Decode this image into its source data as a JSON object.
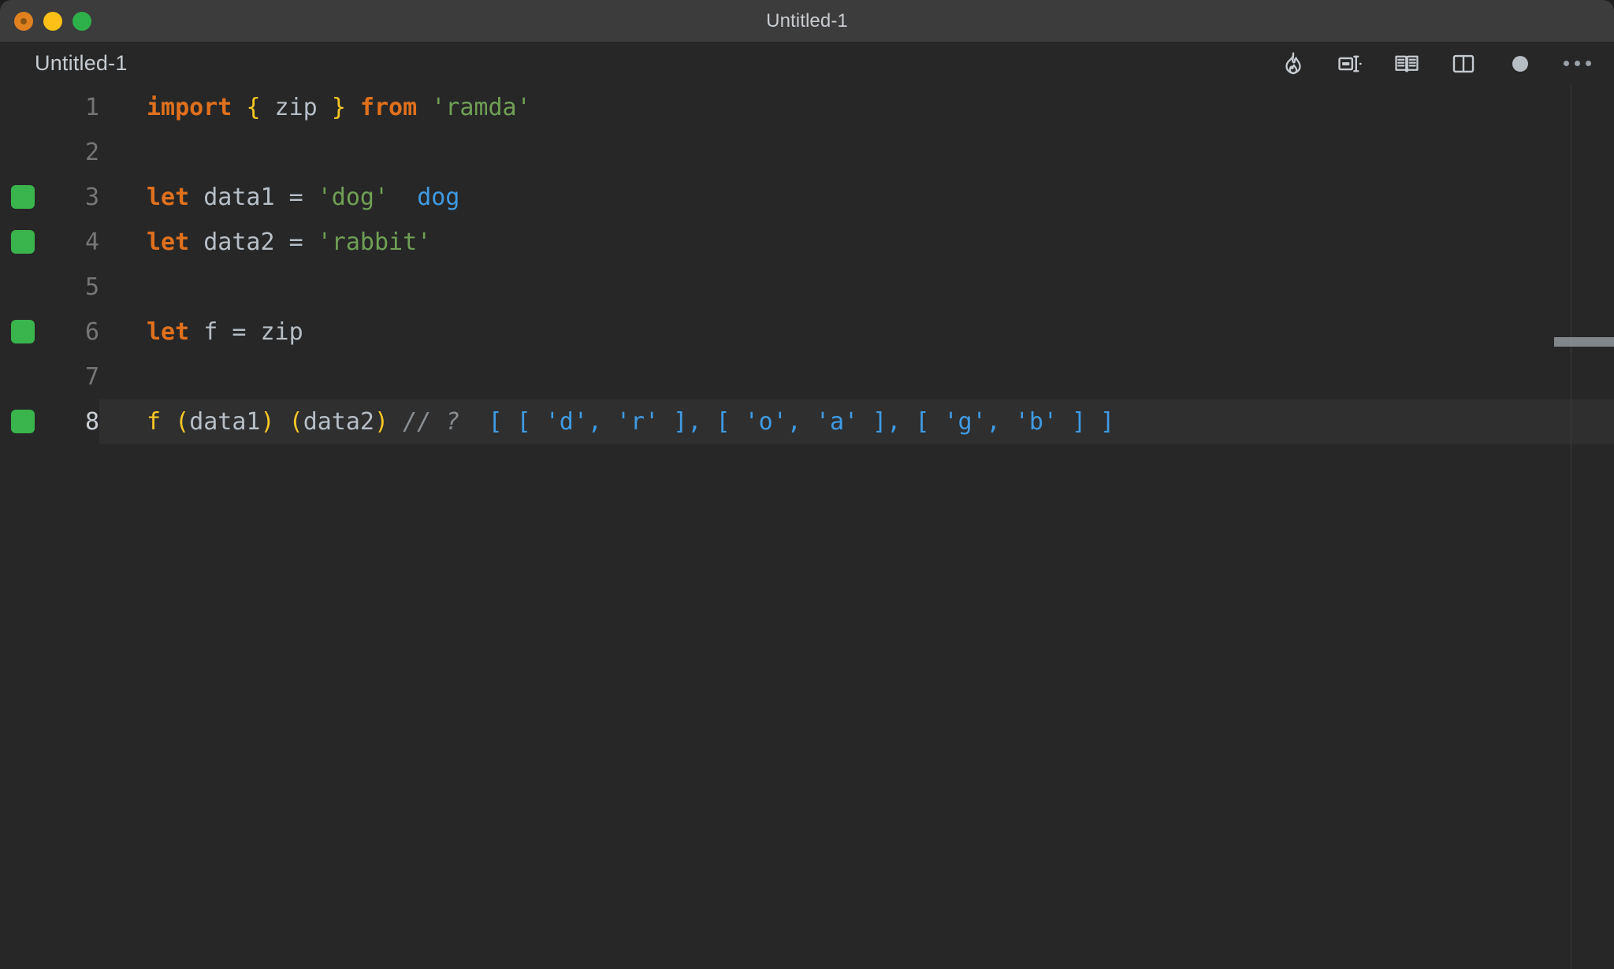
{
  "window": {
    "title": "Untitled-1",
    "traffic_lights": [
      {
        "name": "close",
        "color": "#e0811f"
      },
      {
        "name": "minimize",
        "color": "#fcc016"
      },
      {
        "name": "maximize",
        "color": "#2eb04a"
      }
    ]
  },
  "tab": {
    "label": "Untitled-1"
  },
  "toolbar": {
    "items": [
      {
        "icon": "flame-icon",
        "title": "Start Quokka"
      },
      {
        "icon": "run-to-cursor-icon",
        "title": "Run"
      },
      {
        "icon": "open-book-icon",
        "title": "Open Preview"
      },
      {
        "icon": "split-editor-icon",
        "title": "Split Editor"
      },
      {
        "icon": "unsaved-dot-icon",
        "title": "Unsaved Changes"
      },
      {
        "icon": "more-actions-icon",
        "title": "More Actions..."
      }
    ]
  },
  "editor": {
    "language": "javascript",
    "active_line": 8,
    "coverage_lines": [
      3,
      4,
      6,
      8
    ],
    "lines": [
      {
        "number": "1",
        "covered": false,
        "active": false,
        "tokens": [
          {
            "text": "import",
            "kind": "keyword"
          },
          {
            "text": " ",
            "kind": "plain"
          },
          {
            "text": "{",
            "kind": "bracket"
          },
          {
            "text": " zip ",
            "kind": "plain"
          },
          {
            "text": "}",
            "kind": "bracket"
          },
          {
            "text": " ",
            "kind": "plain"
          },
          {
            "text": "from",
            "kind": "keyword"
          },
          {
            "text": " ",
            "kind": "plain"
          },
          {
            "text": "'ramda'",
            "kind": "string"
          }
        ]
      },
      {
        "number": "2",
        "covered": false,
        "active": false,
        "tokens": []
      },
      {
        "number": "3",
        "covered": true,
        "active": false,
        "tokens": [
          {
            "text": "let",
            "kind": "keyword"
          },
          {
            "text": " data1 = ",
            "kind": "plain"
          },
          {
            "text": "'dog'",
            "kind": "string"
          },
          {
            "text": "  ",
            "kind": "plain"
          },
          {
            "text": "dog",
            "kind": "value"
          }
        ]
      },
      {
        "number": "4",
        "covered": true,
        "active": false,
        "tokens": [
          {
            "text": "let",
            "kind": "keyword"
          },
          {
            "text": " data2 = ",
            "kind": "plain"
          },
          {
            "text": "'rabbit'",
            "kind": "string"
          }
        ]
      },
      {
        "number": "5",
        "covered": false,
        "active": false,
        "tokens": []
      },
      {
        "number": "6",
        "covered": true,
        "active": false,
        "tokens": [
          {
            "text": "let",
            "kind": "keyword"
          },
          {
            "text": " f = zip",
            "kind": "plain"
          }
        ]
      },
      {
        "number": "7",
        "covered": false,
        "active": false,
        "tokens": []
      },
      {
        "number": "8",
        "covered": true,
        "active": true,
        "tokens": [
          {
            "text": "f ",
            "kind": "function"
          },
          {
            "text": "(",
            "kind": "bracket"
          },
          {
            "text": "data1",
            "kind": "plain"
          },
          {
            "text": ")",
            "kind": "bracket"
          },
          {
            "text": " ",
            "kind": "plain"
          },
          {
            "text": "(",
            "kind": "bracket"
          },
          {
            "text": "data2",
            "kind": "plain"
          },
          {
            "text": ")",
            "kind": "bracket"
          },
          {
            "text": " ",
            "kind": "plain"
          },
          {
            "text": "// ?",
            "kind": "comment"
          },
          {
            "text": "  ",
            "kind": "plain"
          },
          {
            "text": "[ [ 'd', 'r' ], [ 'o', 'a' ], [ 'g', 'b' ] ]",
            "kind": "value"
          }
        ]
      }
    ]
  },
  "colors": {
    "titlebar_bg": "#3c3c3c",
    "editor_bg": "#272727",
    "active_line_bg": "#2f2f2f",
    "coverage_green": "#3ab44c",
    "keyword": "#e0701c",
    "bracket_yellow": "#f8c725",
    "string_green": "#6fa055",
    "plain_text": "#b7bfc7",
    "comment_gray": "#8a8f94",
    "inline_value_blue": "#3f9be4",
    "line_number": "#767676",
    "line_number_active": "#c9ced4"
  }
}
